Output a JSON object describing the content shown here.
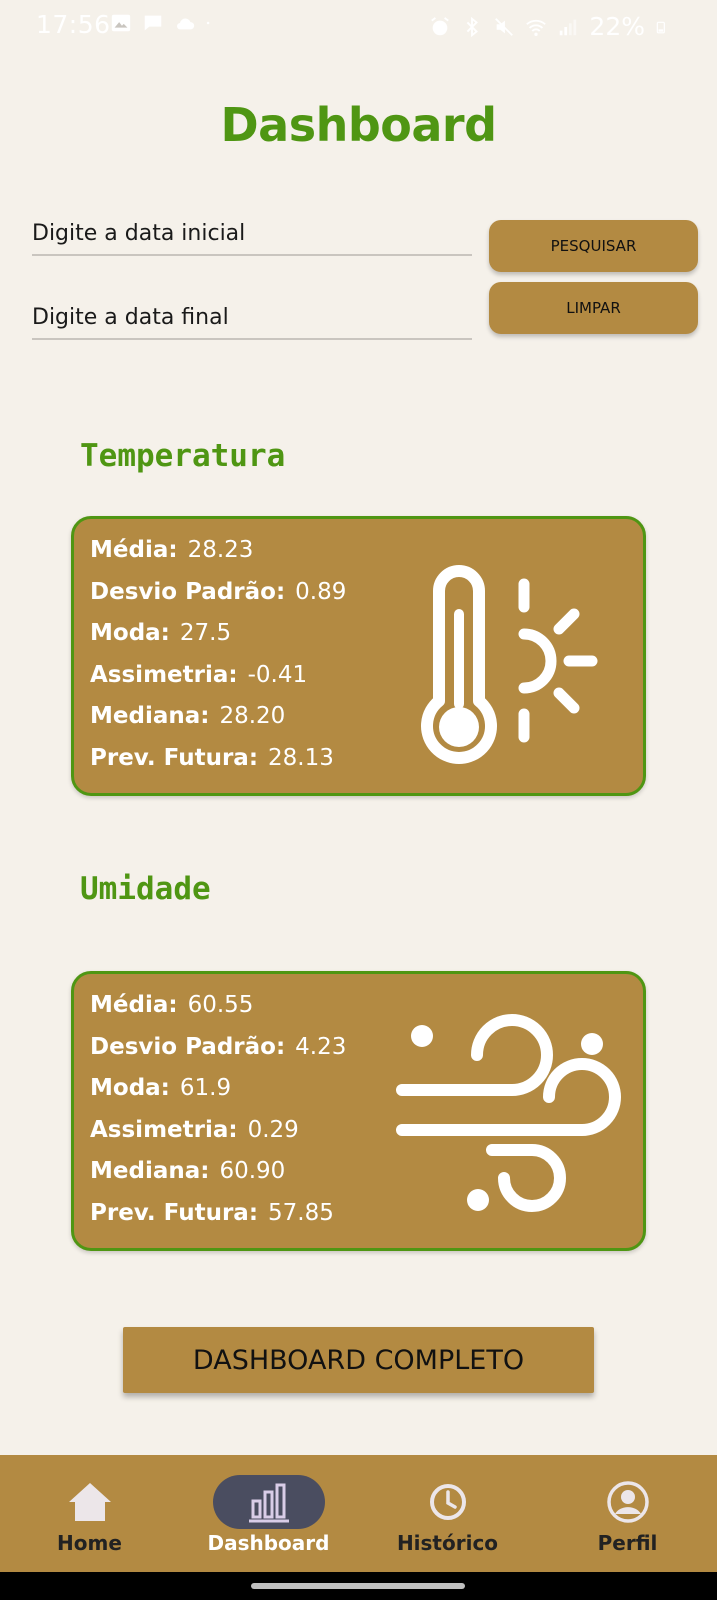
{
  "status_bar": {
    "time": "17:56",
    "battery": "22%",
    "left_icons": [
      "image-icon",
      "message-icon",
      "cloud-icon",
      "dot-icon"
    ],
    "right_icons": [
      "alarm-icon",
      "bluetooth-icon",
      "mute-icon",
      "wifi-icon",
      "signal-icon"
    ]
  },
  "page_title": "Dashboard",
  "search": {
    "start_placeholder": "Digite a data inicial",
    "end_placeholder": "Digite a data final",
    "start_value": "",
    "end_value": "",
    "search_label": "PESQUISAR",
    "clear_label": "LIMPAR"
  },
  "temperature": {
    "title": "Temperatura",
    "icon": "thermometer-sun-icon",
    "stats": [
      {
        "label": "Média:",
        "value": "28.23"
      },
      {
        "label": "Desvio Padrão:",
        "value": "0.89"
      },
      {
        "label": "Moda:",
        "value": "27.5"
      },
      {
        "label": "Assimetria:",
        "value": "-0.41"
      },
      {
        "label": "Mediana:",
        "value": "28.20"
      },
      {
        "label": "Prev. Futura:",
        "value": "28.13"
      }
    ]
  },
  "humidity": {
    "title": "Umidade",
    "icon": "wind-icon",
    "stats": [
      {
        "label": "Média:",
        "value": "60.55"
      },
      {
        "label": "Desvio Padrão:",
        "value": "4.23"
      },
      {
        "label": "Moda:",
        "value": "61.9"
      },
      {
        "label": "Assimetria:",
        "value": "0.29"
      },
      {
        "label": "Mediana:",
        "value": "60.90"
      },
      {
        "label": "Prev. Futura:",
        "value": "57.85"
      }
    ]
  },
  "full_dashboard_label": "DASHBOARD COMPLETO",
  "nav": {
    "items": [
      {
        "label": "Home",
        "icon": "home-icon",
        "active": false
      },
      {
        "label": "Dashboard",
        "icon": "bar-chart-icon",
        "active": true
      },
      {
        "label": "Histórico",
        "icon": "clock-icon",
        "active": false
      },
      {
        "label": "Perfil",
        "icon": "profile-icon",
        "active": false
      }
    ]
  },
  "colors": {
    "background": "#f5f1ea",
    "accent_green": "#4f9613",
    "card_brown": "#b38a42",
    "nav_active_pill": "#4a4d60"
  }
}
